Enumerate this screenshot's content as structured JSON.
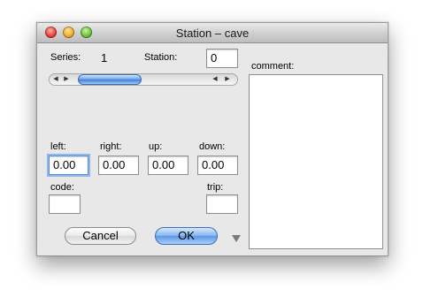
{
  "window": {
    "title": "Station – cave"
  },
  "series": {
    "label": "Series:",
    "value": "1"
  },
  "station": {
    "label": "Station:",
    "value": "0"
  },
  "comment": {
    "label": "comment:",
    "value": ""
  },
  "scrollbar": {
    "left_arrow": "◀",
    "right_arrow": "▶"
  },
  "dims": {
    "left_label": "left:",
    "left_value": "0.00",
    "right_label": "right:",
    "right_value": "0.00",
    "up_label": "up:",
    "up_value": "0.00",
    "down_label": "down:",
    "down_value": "0.00"
  },
  "code": {
    "label": "code:",
    "value": ""
  },
  "trip": {
    "label": "trip:",
    "value": ""
  },
  "buttons": {
    "cancel": "Cancel",
    "ok": "OK"
  },
  "icons": {
    "disclosure": "disclosure-triangle-icon"
  },
  "colors": {
    "accent": "#5b98e4",
    "window_bg": "#e8e8e8"
  }
}
